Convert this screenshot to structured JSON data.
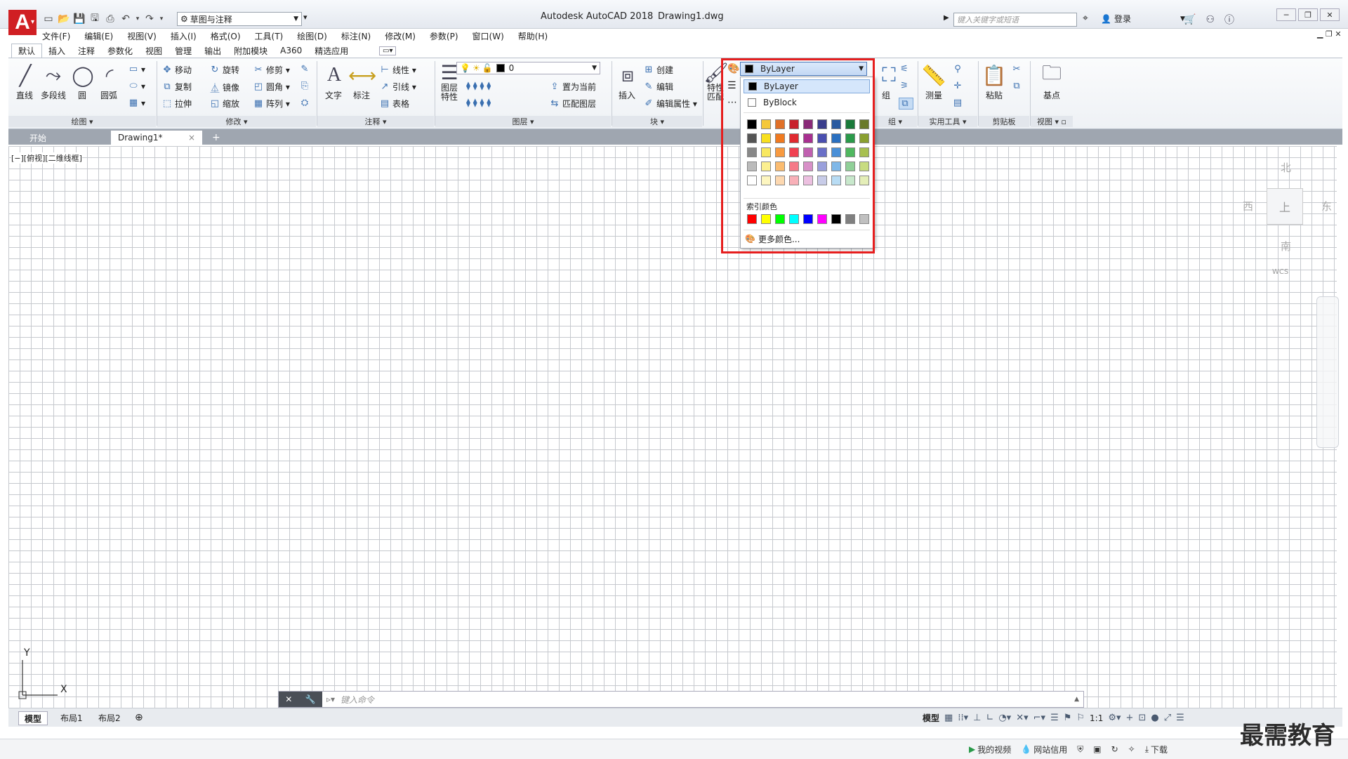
{
  "app": {
    "logo_letter": "A",
    "title": "Autodesk AutoCAD 2018",
    "file": "Drawing1.dwg",
    "workspace": "草图与注释",
    "search_placeholder": "键入关键字或短语",
    "login": "登录"
  },
  "menu": [
    "文件(F)",
    "编辑(E)",
    "视图(V)",
    "插入(I)",
    "格式(O)",
    "工具(T)",
    "绘图(D)",
    "标注(N)",
    "修改(M)",
    "参数(P)",
    "窗口(W)",
    "帮助(H)"
  ],
  "ribbon_tabs": [
    "默认",
    "插入",
    "注释",
    "参数化",
    "视图",
    "管理",
    "输出",
    "附加模块",
    "A360",
    "精选应用"
  ],
  "ribbon": {
    "draw": {
      "label": "绘图",
      "line": "直线",
      "polyline": "多段线",
      "circle": "圆",
      "arc": "圆弧"
    },
    "modify": {
      "label": "修改",
      "move": "移动",
      "rotate": "旋转",
      "trim": "修剪",
      "copy": "复制",
      "mirror": "镜像",
      "fillet": "圆角",
      "stretch": "拉伸",
      "scale": "缩放",
      "array": "阵列"
    },
    "annotation": {
      "label": "注释",
      "text": "文字",
      "dimension": "标注",
      "linear": "线性",
      "leader": "引线",
      "table": "表格"
    },
    "layers": {
      "label": "图层",
      "properties": "图层\n特性",
      "current_layer": "0",
      "make_current": "置为当前",
      "match_layer": "匹配图层"
    },
    "block": {
      "label": "块",
      "insert": "插入",
      "create": "创建",
      "edit": "编辑",
      "edit_attr": "编辑属性"
    },
    "properties": {
      "match": "特性\n匹配"
    },
    "groups": {
      "label": "组",
      "group": "组"
    },
    "utilities": {
      "label": "实用工具",
      "measure": "测量"
    },
    "clipboard": {
      "label": "剪贴板",
      "paste": "粘贴"
    },
    "view": {
      "label": "视图",
      "base": "基点"
    }
  },
  "doc_tabs": {
    "start": "开始",
    "drawing": "Drawing1*",
    "close": "×",
    "add": "+"
  },
  "viewport_label": "[−][俯视][二维线框]",
  "viewcube": {
    "north": "北",
    "south": "南",
    "east": "东",
    "west": "西",
    "top": "上",
    "wcs": "WCS"
  },
  "ucs": {
    "x": "X",
    "y": "Y"
  },
  "command": {
    "placeholder": "键入命令"
  },
  "layout_tabs": [
    "模型",
    "布局1",
    "布局2"
  ],
  "status": {
    "model": "模型",
    "scale": "1:1"
  },
  "taskbar": {
    "video": "我的视频",
    "credit": "网站信用",
    "download": "下载"
  },
  "watermark": "最需教育",
  "color_dropdown": {
    "selected": "ByLayer",
    "items": [
      "ByLayer",
      "ByBlock"
    ],
    "index_colors_label": "索引颜色",
    "more_colors": "更多颜色...",
    "palette": [
      [
        "#000000",
        "#f5c83a",
        "#e07028",
        "#c8202c",
        "#8a2a78",
        "#3a3d8c",
        "#2a5aa0",
        "#1a7a3a",
        "#6a7a2a"
      ],
      [
        "#555555",
        "#f8e020",
        "#f07a20",
        "#e02a30",
        "#a83090",
        "#4a4fb0",
        "#2a70c0",
        "#2a9a4a",
        "#8aa030"
      ],
      [
        "#888888",
        "#f8e860",
        "#f89a40",
        "#f04050",
        "#c060b0",
        "#6a70c8",
        "#4a90d8",
        "#50b860",
        "#a8c050"
      ],
      [
        "#bbbbbb",
        "#fbef90",
        "#fbbc70",
        "#f57a88",
        "#d890c8",
        "#9aa0dc",
        "#80b8e8",
        "#90d098",
        "#c8dc80"
      ],
      [
        "#ffffff",
        "#fdf6c0",
        "#fdd8b0",
        "#f8b0b8",
        "#ecc0e0",
        "#c8cce8",
        "#b8dcf4",
        "#c8e8cc",
        "#e4eeb8"
      ]
    ],
    "index_colors": [
      "#ff0000",
      "#ffff00",
      "#00ff00",
      "#00ffff",
      "#0000ff",
      "#ff00ff",
      "#000000",
      "#808080",
      "#c0c0c0"
    ],
    "highlight_color": "#e61e1e"
  }
}
